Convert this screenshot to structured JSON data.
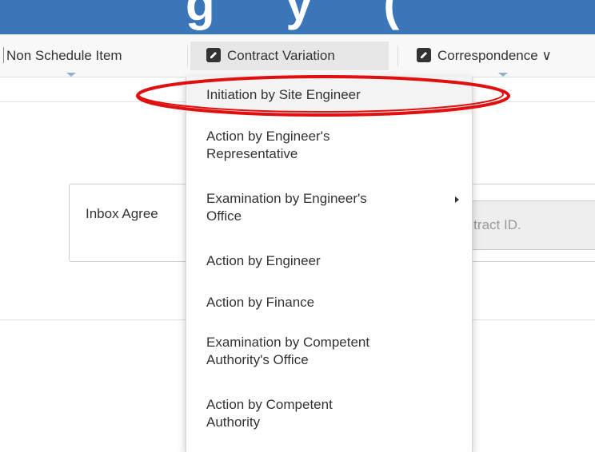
{
  "nav": {
    "items": [
      {
        "label": "Non Schedule Item"
      },
      {
        "label": "Contract Variation",
        "icon": "edit-icon"
      },
      {
        "label": "Correspondence ∨",
        "icon": "edit-icon"
      }
    ]
  },
  "dropdown": {
    "items": [
      {
        "label": "Initiation by Site Engineer"
      },
      {
        "line1": "Action by Engineer's",
        "line2": "Representative"
      },
      {
        "line1": "Examination by Engineer's",
        "line2": "Office",
        "has_submenu": true
      },
      {
        "label": "Action by Engineer"
      },
      {
        "label": "Action by Finance"
      },
      {
        "line1": "Examination by Competent",
        "line2": "Authority's Office"
      },
      {
        "line1": "Action by Competent",
        "line2": "Authority"
      }
    ]
  },
  "inbox": {
    "label": "Inbox Agree",
    "contract_placeholder": "Contract ID."
  },
  "colors": {
    "banner": "#3a76b8",
    "annotation": "#e01010"
  }
}
